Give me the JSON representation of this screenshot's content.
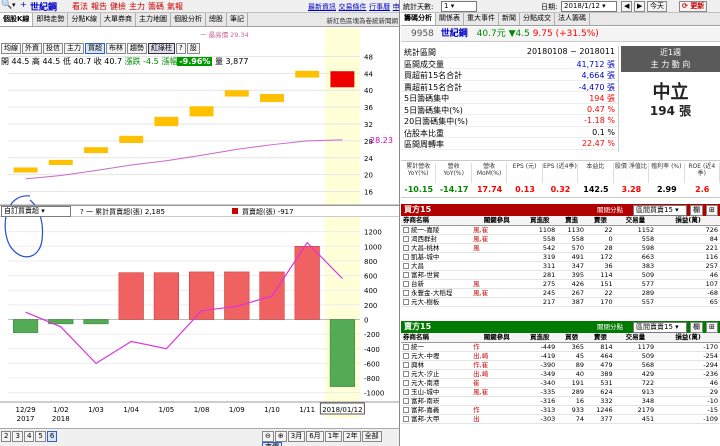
{
  "left": {
    "top": {
      "stock": "世紀鋼",
      "red_tabs": [
        "看法",
        "報告",
        "健檢",
        "主力",
        "籌碼",
        "氣報"
      ],
      "links": [
        "最新資訊",
        "交易條件",
        "行事曆",
        "申購條件"
      ]
    },
    "tabs": [
      "個股K線",
      "即時走勢",
      "分點K線",
      "大單券商",
      "主力地圖",
      "個股分析",
      "總股",
      "筆記"
    ],
    "tabs_right": "新紅色區塊為卷統新聞網",
    "chips": [
      "均線",
      "外資",
      "投信",
      "主力",
      "買超",
      "布林",
      "趨勢",
      "紅綠柱",
      "?",
      "設"
    ],
    "ohlc": {
      "open": "開 44.5",
      "high": "高 44.5",
      "low": "低 40.7",
      "close": "收 40.7",
      "change": "漲跌 -4.5",
      "pct_label": "漲幅",
      "pct": "-9.96%",
      "volume_label": "量",
      "volume": "3,877"
    },
    "price_note": "一 最高價 29.34",
    "price_axis": [
      "48",
      "44",
      "40",
      "36",
      "32",
      "28",
      "24",
      "20",
      "16"
    ],
    "price_last": "28.23",
    "lower": {
      "select": "自訂買賣超",
      "legend1": "? 一 累計買賣超(張) 2,185",
      "legend2": "買賣超(張) -917",
      "axis": [
        "1200",
        "1000",
        "800",
        "600",
        "400",
        "200",
        "0",
        "-200",
        "-400",
        "-600",
        "-800",
        "-1000"
      ]
    },
    "xaxis": [
      {
        "label": "12/29",
        "sub": "2017"
      },
      {
        "label": "1/02",
        "sub": "2018"
      },
      {
        "label": "1/03",
        "sub": ""
      },
      {
        "label": "1/04",
        "sub": ""
      },
      {
        "label": "1/05",
        "sub": ""
      },
      {
        "label": "1/08",
        "sub": ""
      },
      {
        "label": "1/09",
        "sub": ""
      },
      {
        "label": "1/10",
        "sub": ""
      },
      {
        "label": "1/11",
        "sub": ""
      },
      {
        "label": "2018/01/12",
        "sub": ""
      }
    ],
    "bottom_pages": [
      "2",
      "3",
      "4",
      "5",
      "6"
    ],
    "bottom_ranges": [
      "3月",
      "6月",
      "1年",
      "2年",
      "全部",
      "查價"
    ]
  },
  "right": {
    "top": {
      "left_label": "統計天數:",
      "days": "1",
      "date_label": "日期:",
      "date": "2018/1/12",
      "today": "今天",
      "update": "更新"
    },
    "tabs": [
      "籌碼分析",
      "關係表",
      "重大事件",
      "新聞",
      "分點成交",
      "法人籌碼"
    ],
    "quote": {
      "code": "9958",
      "name": "世紀鋼",
      "price": "40.7元",
      "change": "▼4.5",
      "change2": "9.75 (+31.5%)"
    },
    "stats": [
      {
        "label": "統計區間",
        "value": "20180108 ~ 2018011"
      },
      {
        "label": "區間成交量",
        "value": "41,712 張"
      },
      {
        "label": "買超前15名合計",
        "value": "4,664 張"
      },
      {
        "label": "賣超前15名合計",
        "value": "-4,470 張"
      },
      {
        "label": "5日籌碼集中",
        "value": "194 張"
      },
      {
        "label": "5日籌碼集中(%)",
        "value": "0.47 %"
      },
      {
        "label": "20日籌碼集中(%)",
        "value": "-1.18 %"
      },
      {
        "label": "佔股本比重",
        "value": "0.1 %"
      },
      {
        "label": "區間周轉率",
        "value": "22.47 %"
      }
    ],
    "box": {
      "line1": "近1週",
      "line2": "主 力 動 向",
      "big": "中立",
      "amount": "194 張"
    },
    "fund_heads": [
      "累計營收 YoY(%)",
      "營收 YoY(%)",
      "營收 MoM(%)",
      "EPS (元)",
      "EPS (近4季)",
      "本益比",
      "股價 淨值比",
      "殖利率 (%)",
      "ROE (近4季)"
    ],
    "fund_vals": [
      "-10.15",
      "-14.17",
      "17.74",
      "0.13",
      "0.32",
      "142.5",
      "3.28",
      "2.99",
      "2.6"
    ],
    "buy": {
      "title": "買方15",
      "filter": "關閉分點",
      "filter_sel": "區間買賣15",
      "heads": [
        "券商名稱",
        "關鍵參與",
        "買進股",
        "賣進",
        "賣張",
        "交易量",
        "損益(萬)"
      ],
      "rows": [
        [
          "統一-嘉陵",
          "風,崔",
          "1108",
          "1130",
          "22",
          "1152",
          "726"
        ],
        [
          "渴西群封",
          "風,崔",
          "558",
          "558",
          "0",
          "558",
          "84"
        ],
        [
          "大昌-桃林",
          "風",
          "542",
          "570",
          "28",
          "598",
          "221"
        ],
        [
          "凱基-城中",
          "",
          "319",
          "491",
          "172",
          "663",
          "116"
        ],
        [
          "大昌",
          "",
          "311",
          "347",
          "36",
          "383",
          "257"
        ],
        [
          "富邦-世貿",
          "",
          "281",
          "395",
          "114",
          "509",
          "46"
        ],
        [
          "台新",
          "風",
          "275",
          "426",
          "151",
          "577",
          "107"
        ],
        [
          "永豐金-大稻埕",
          "風,崔",
          "245",
          "267",
          "22",
          "289",
          "-68"
        ],
        [
          "元大-樹板",
          "",
          "217",
          "387",
          "170",
          "557",
          "65"
        ]
      ]
    },
    "sell": {
      "title": "賣方15",
      "filter": "關閉分點",
      "filter_sel": "區間賣賣15",
      "heads": [
        "券商名稱",
        "關鍵參與",
        "買進股",
        "買張",
        "賣張",
        "交易量",
        "損益(萬)"
      ],
      "rows": [
        [
          "統一",
          "作",
          "-449",
          "365",
          "814",
          "1179",
          "-170"
        ],
        [
          "元大-中壢",
          "出,崎",
          "-419",
          "45",
          "464",
          "509",
          "-254"
        ],
        [
          "興林",
          "作,崔",
          "-390",
          "89",
          "479",
          "568",
          "-294"
        ],
        [
          "元大-汐止",
          "出,崎",
          "-349",
          "40",
          "389",
          "429",
          "-236"
        ],
        [
          "元大-南港",
          "崔",
          "-340",
          "191",
          "531",
          "722",
          "46"
        ],
        [
          "玉山-城中",
          "風,崔",
          "-335",
          "289",
          "624",
          "913",
          "29"
        ],
        [
          "富邦-南崁",
          "",
          "-316",
          "16",
          "332",
          "348",
          "-10"
        ],
        [
          "富邦-嘉義",
          "作",
          "-313",
          "933",
          "1246",
          "2179",
          "-15"
        ],
        [
          "富邦-大甲",
          "出",
          "-303",
          "74",
          "377",
          "451",
          "-109"
        ]
      ]
    }
  },
  "chart_data": {
    "type": "bar",
    "title": "",
    "categories": [
      "12/29",
      "1/02",
      "1/03",
      "1/04",
      "1/05",
      "1/08",
      "1/09",
      "1/10",
      "1/11",
      "2018/01/12"
    ],
    "price_candles": [
      {
        "open": 20.5,
        "close": 21.7
      },
      {
        "open": 22.3,
        "close": 23.5
      },
      {
        "open": 25.1,
        "close": 26.5
      },
      {
        "open": 27.5,
        "close": 29.2
      },
      {
        "open": 31.5,
        "close": 33.7
      },
      {
        "open": 33.8,
        "close": 36.2
      },
      {
        "open": 38.5,
        "close": 40.0
      },
      {
        "open": 37.2,
        "close": 39.1
      },
      {
        "open": 43.0,
        "close": 44.6
      },
      {
        "open": 44.5,
        "close": 40.7
      }
    ],
    "price_ylim": [
      14,
      50
    ],
    "ma_line": [
      19.0,
      19.8,
      21.0,
      22.3,
      23.3,
      24.6,
      26.0,
      27.1,
      28.0,
      28.23
    ],
    "series": [
      {
        "name": "買賣超(張)",
        "values": [
          -180,
          -60,
          -60,
          640,
          640,
          650,
          650,
          650,
          1000,
          -917
        ]
      },
      {
        "name": "累計買賣超(張)",
        "values": [
          100,
          -100,
          -600,
          -300,
          -400,
          120,
          180,
          320,
          1050,
          560
        ]
      }
    ],
    "ylim": [
      -1100,
      1250
    ]
  }
}
